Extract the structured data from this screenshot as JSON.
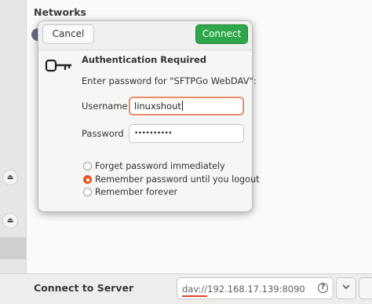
{
  "background": {
    "networks_title": "Networks",
    "connect_to_server_label": "Connect to Server",
    "server_address": "dav://192.168.17.139:8090",
    "help_icon": "?",
    "dropdown_icon": "chevron-down-icon"
  },
  "dialog": {
    "cancel_label": "Cancel",
    "connect_label": "Connect",
    "title": "Authentication Required",
    "message": "Enter password for \"SFTPGo WebDAV\":",
    "username_label": "Username",
    "username_value": "linuxshout",
    "password_label": "Password",
    "password_value": "••••••••••",
    "options": [
      {
        "label": "Forget password immediately",
        "checked": false
      },
      {
        "label": "Remember password until you logout",
        "checked": true
      },
      {
        "label": "Remember forever",
        "checked": false
      }
    ]
  },
  "colors": {
    "accent": "#e95420",
    "connect_button": "#2ea64a"
  }
}
